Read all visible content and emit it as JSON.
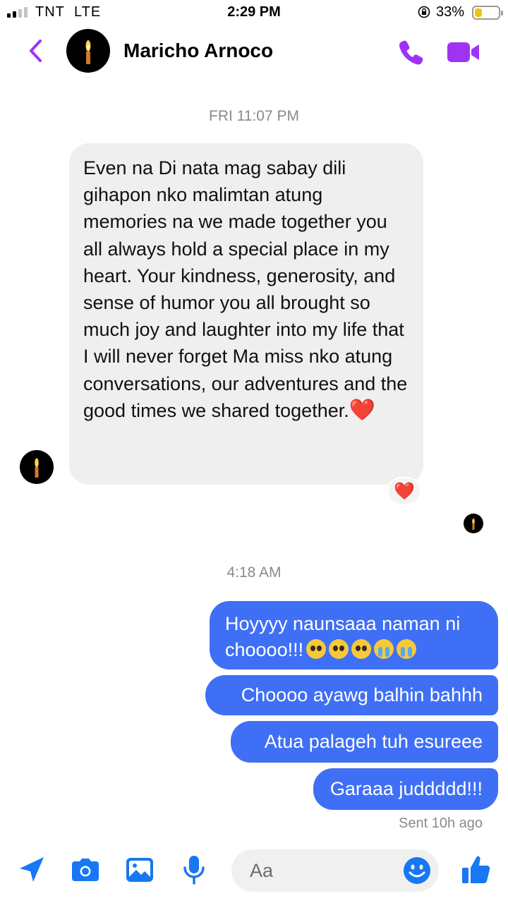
{
  "status_bar": {
    "carrier": "TNT",
    "network": "LTE",
    "time": "2:29 PM",
    "battery_percent": "33%",
    "battery_level": 0.33,
    "signal_bars_active": 2,
    "signal_bars_total": 4
  },
  "header": {
    "contact_name": "Maricho Arnoco",
    "back_icon": "chevron-left-icon",
    "call_icon": "phone-icon",
    "video_icon": "video-camera-icon",
    "accent_color": "#a033f3"
  },
  "thread": {
    "timestamp_1": "FRI 11:07 PM",
    "incoming_message": "Even na Di nata mag sabay dili gihapon nko malimtan atung memories na we made together you all always hold a special place in my heart. Your kindness, generosity, and sense of humor you all brought so much joy and laughter into my life that I will never forget Ma miss nko atung conversations, our adventures and the good times we shared together.",
    "incoming_emoji": "❤️",
    "reaction": "❤️",
    "timestamp_2": "4:18 AM",
    "outgoing": [
      {
        "text": "Hoyyyy naunsaaa naman ni choooo!!!",
        "emoji": "🥺🥺🥺😭😭"
      },
      {
        "text": "Choooo ayawg balhin bahhh"
      },
      {
        "text": "Atua palageh tuh esureee"
      },
      {
        "text": "Garaaa juddddd!!!"
      }
    ],
    "sent_status": "Sent 10h ago",
    "outgoing_bubble_color": "#3f6ff5",
    "incoming_bubble_color": "#efeff0"
  },
  "composer": {
    "placeholder": "Aa",
    "icons": [
      "send-location-icon",
      "camera-icon",
      "image-icon",
      "microphone-icon",
      "emoji-icon",
      "thumbs-up-icon"
    ],
    "icon_color": "#1877f2"
  }
}
